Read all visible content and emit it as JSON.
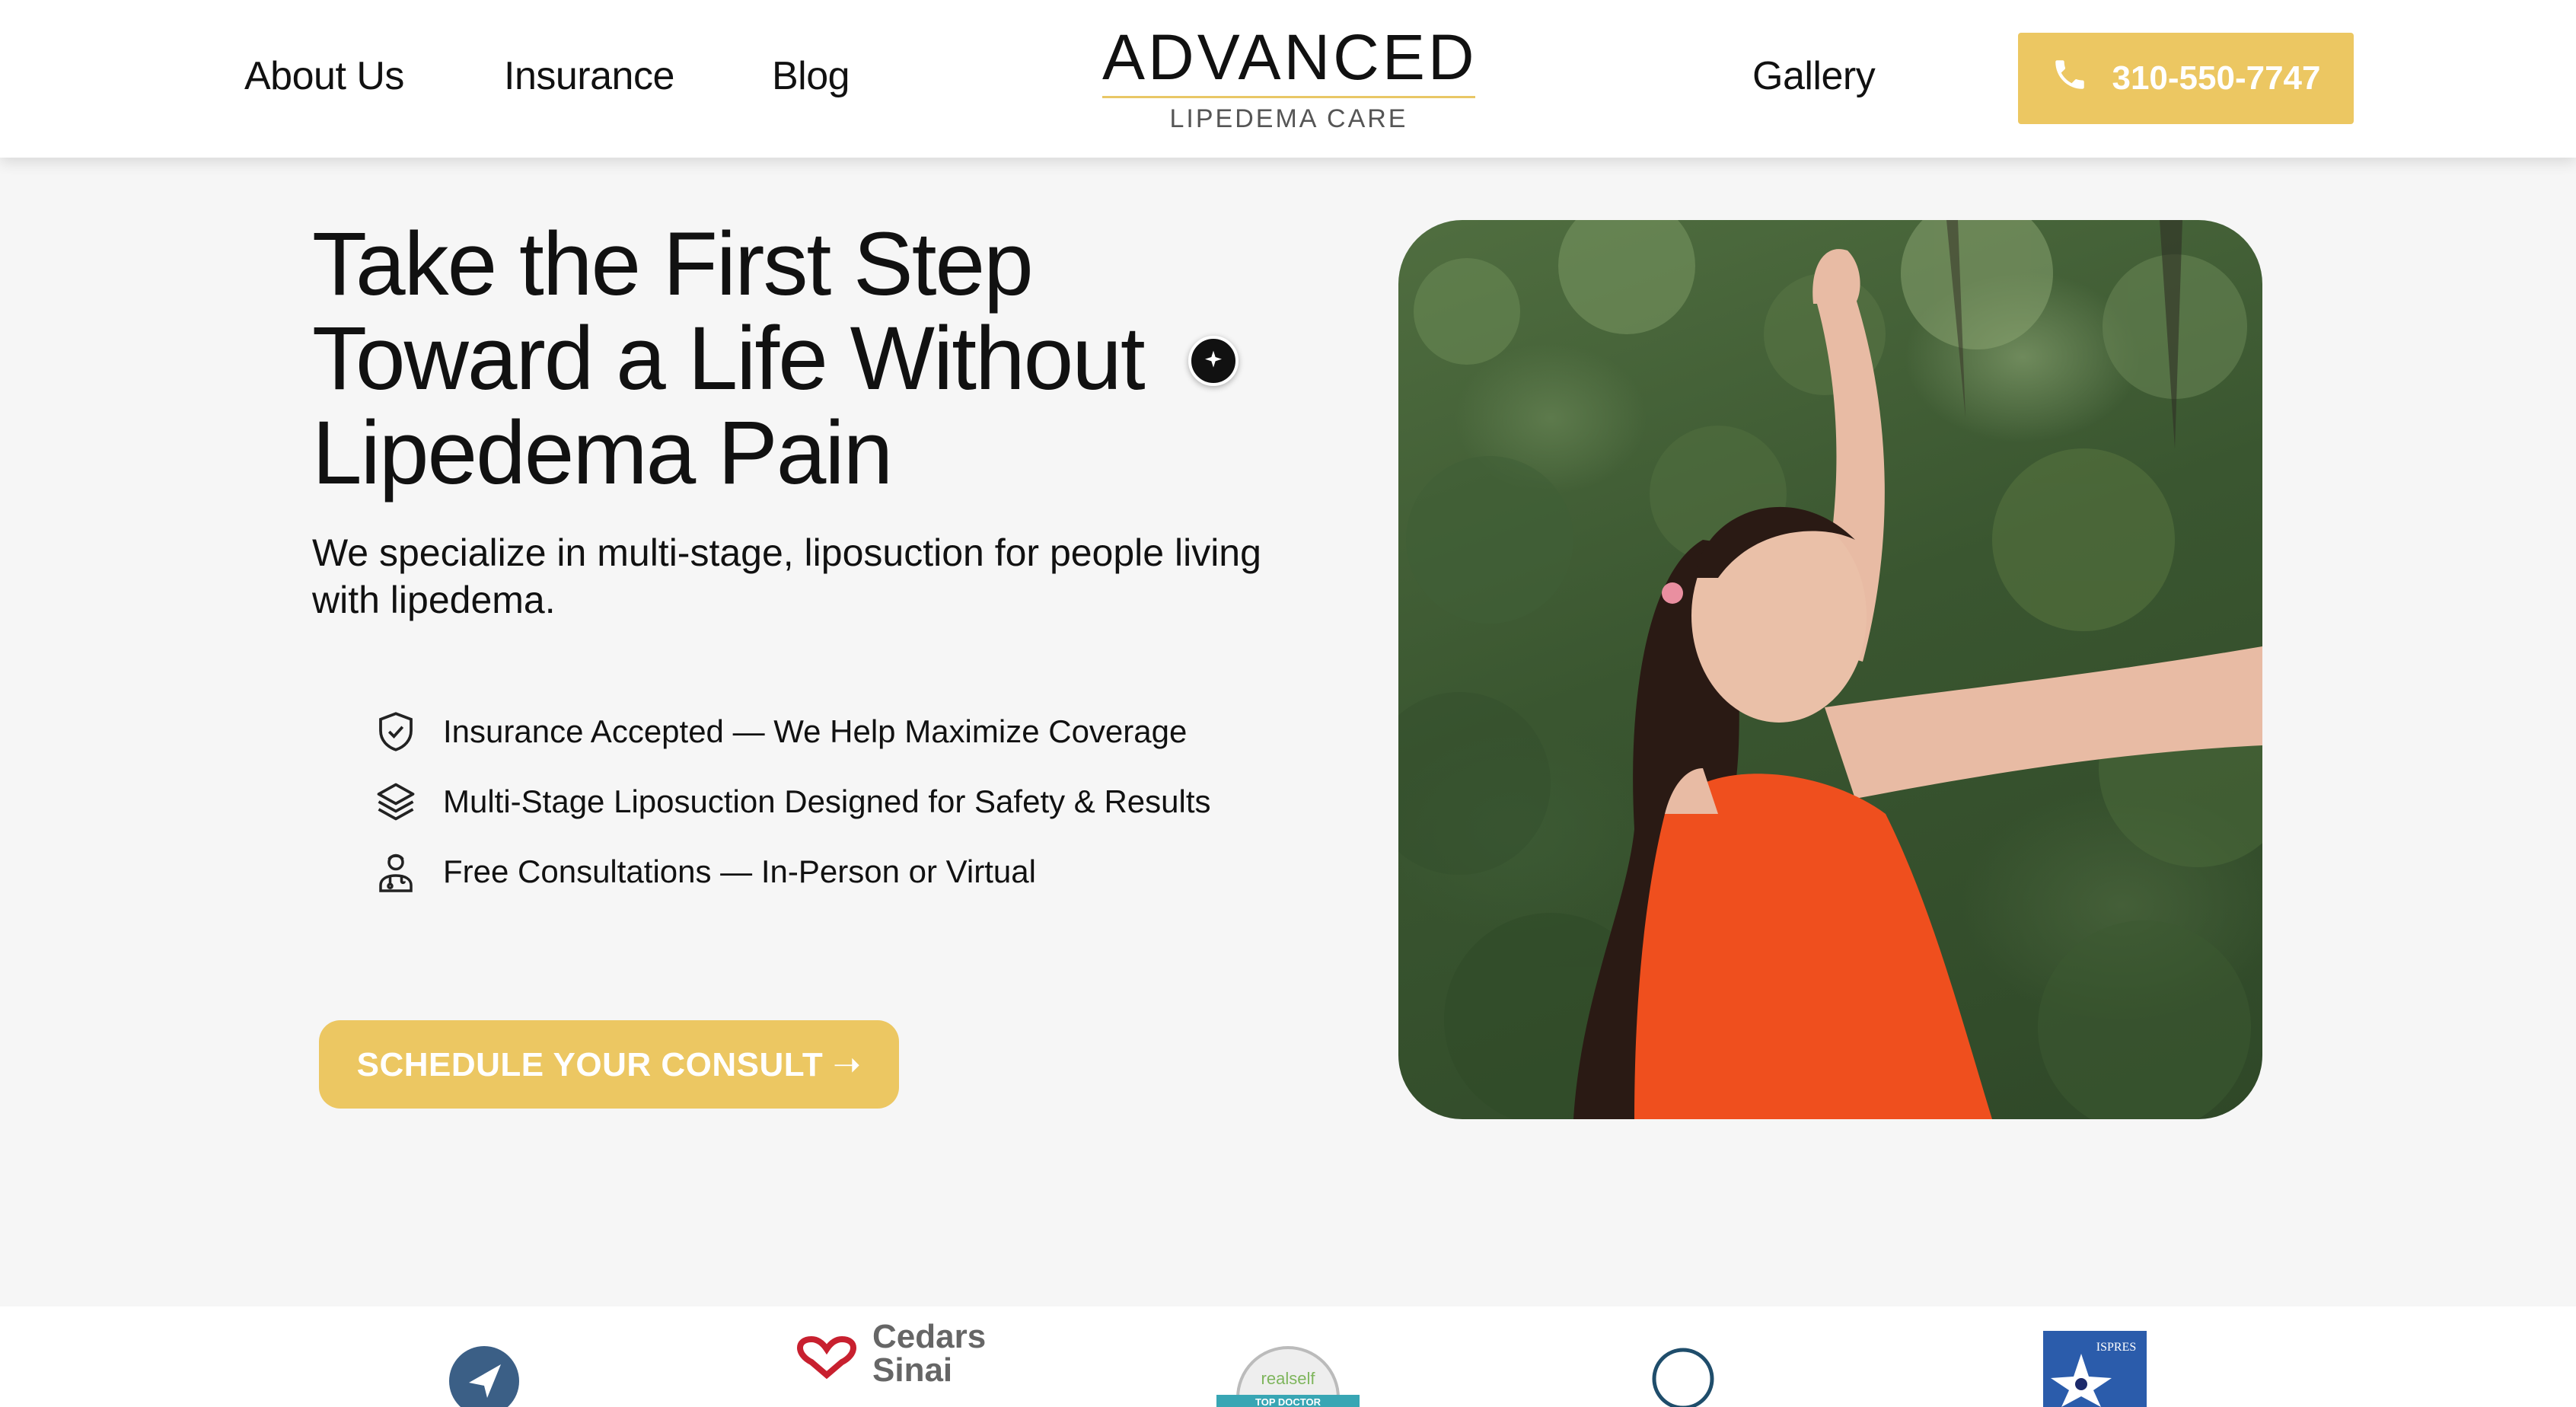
{
  "header": {
    "nav_left": [
      "About Us",
      "Insurance",
      "Blog"
    ],
    "logo_top": "ADVANCED",
    "logo_bottom": "LIPEDEMA CARE",
    "nav_right": "Gallery",
    "phone": "310-550-7747",
    "phone_icon": "phone-icon"
  },
  "hero": {
    "title_line1": "Take the First Step",
    "title_line2": "Toward a Life Without",
    "title_line3": "Lipedema Pain",
    "subtitle": "We specialize in multi-stage, liposuction for people living with lipedema.",
    "features": [
      {
        "icon": "shield-check-icon",
        "text": "Insurance Accepted — We Help Maximize Coverage"
      },
      {
        "icon": "layers-icon",
        "text": "Multi-Stage Liposuction Designed for Safety & Results"
      },
      {
        "icon": "doctor-icon",
        "text": "Free Consultations — In-Person or Virtual"
      }
    ],
    "cta": "SCHEDULE YOUR CONSULT ➝"
  },
  "logos": {
    "cedars_line1": "Cedars",
    "cedars_line2": "Sinai",
    "realself_brand": "realself",
    "realself_badge": "TOP DOCTOR",
    "ispres": "ISPRES"
  },
  "colors": {
    "accent": "#ecc762",
    "text": "#111111",
    "background": "#f6f6f6"
  }
}
